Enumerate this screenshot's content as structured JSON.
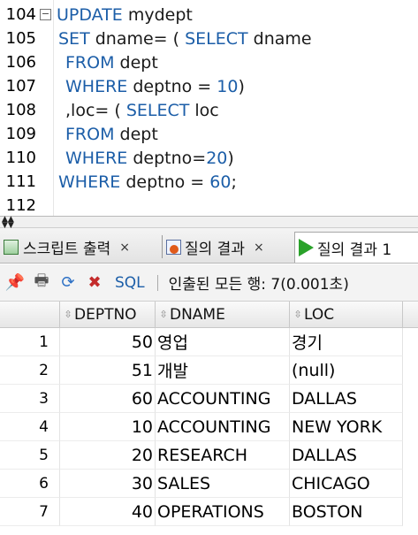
{
  "editor": {
    "lines": [
      {
        "n": "104",
        "tokens": [
          {
            "t": "UPDATE",
            "k": "kw"
          },
          {
            "t": " mydept",
            "k": ""
          }
        ]
      },
      {
        "n": "105",
        "tokens": [
          {
            "t": "SET",
            "k": "kw"
          },
          {
            "t": " dname= ( ",
            "k": ""
          },
          {
            "t": "SELECT",
            "k": "kw"
          },
          {
            "t": " dname",
            "k": ""
          }
        ]
      },
      {
        "n": "106",
        "tokens": [
          {
            "t": "FROM",
            "k": "kw"
          },
          {
            "t": " dept",
            "k": ""
          }
        ]
      },
      {
        "n": "107",
        "tokens": [
          {
            "t": "WHERE",
            "k": "kw"
          },
          {
            "t": " deptno = ",
            "k": ""
          },
          {
            "t": "10",
            "k": "num"
          },
          {
            "t": ")",
            "k": ""
          }
        ]
      },
      {
        "n": "108",
        "tokens": [
          {
            "t": ",loc= ( ",
            "k": ""
          },
          {
            "t": "SELECT",
            "k": "kw"
          },
          {
            "t": " loc",
            "k": ""
          }
        ]
      },
      {
        "n": "109",
        "tokens": [
          {
            "t": "FROM",
            "k": "kw"
          },
          {
            "t": " dept",
            "k": ""
          }
        ]
      },
      {
        "n": "110",
        "tokens": [
          {
            "t": "WHERE",
            "k": "kw"
          },
          {
            "t": " deptno=",
            "k": ""
          },
          {
            "t": "20",
            "k": "num"
          },
          {
            "t": ")",
            "k": ""
          }
        ]
      },
      {
        "n": "111",
        "tokens": [
          {
            "t": "WHERE",
            "k": "kw"
          },
          {
            "t": " deptno = ",
            "k": ""
          },
          {
            "t": "60",
            "k": "num"
          },
          {
            "t": ";",
            "k": ""
          }
        ]
      },
      {
        "n": "112",
        "tokens": []
      }
    ],
    "fold_glyph": "⊟"
  },
  "tabs": [
    {
      "label": "스크립트 출력",
      "close": "×",
      "icon": "script-output-icon"
    },
    {
      "label": "질의 결과",
      "close": "×",
      "icon": "query-result-error-icon"
    },
    {
      "label": "질의 결과 1",
      "close": "",
      "icon": "run-query-icon"
    }
  ],
  "toolbar": {
    "sql_label": "SQL",
    "separator": "|",
    "status": "인출된 모든 행: 7(0.001초)"
  },
  "grid": {
    "columns": [
      "DEPTNO",
      "DNAME",
      "LOC"
    ],
    "rows": [
      {
        "n": "1",
        "deptno": "50",
        "dname": "영업",
        "loc": "경기"
      },
      {
        "n": "2",
        "deptno": "51",
        "dname": "개발",
        "loc": "(null)"
      },
      {
        "n": "3",
        "deptno": "60",
        "dname": "ACCOUNTING",
        "loc": "DALLAS"
      },
      {
        "n": "4",
        "deptno": "10",
        "dname": "ACCOUNTING",
        "loc": "NEW YORK"
      },
      {
        "n": "5",
        "deptno": "20",
        "dname": "RESEARCH",
        "loc": "DALLAS"
      },
      {
        "n": "6",
        "deptno": "30",
        "dname": "SALES",
        "loc": "CHICAGO"
      },
      {
        "n": "7",
        "deptno": "40",
        "dname": "OPERATIONS",
        "loc": "BOSTON"
      }
    ]
  },
  "colors": {
    "keyword": "#1c5ea8",
    "text": "#1a1a1a"
  }
}
